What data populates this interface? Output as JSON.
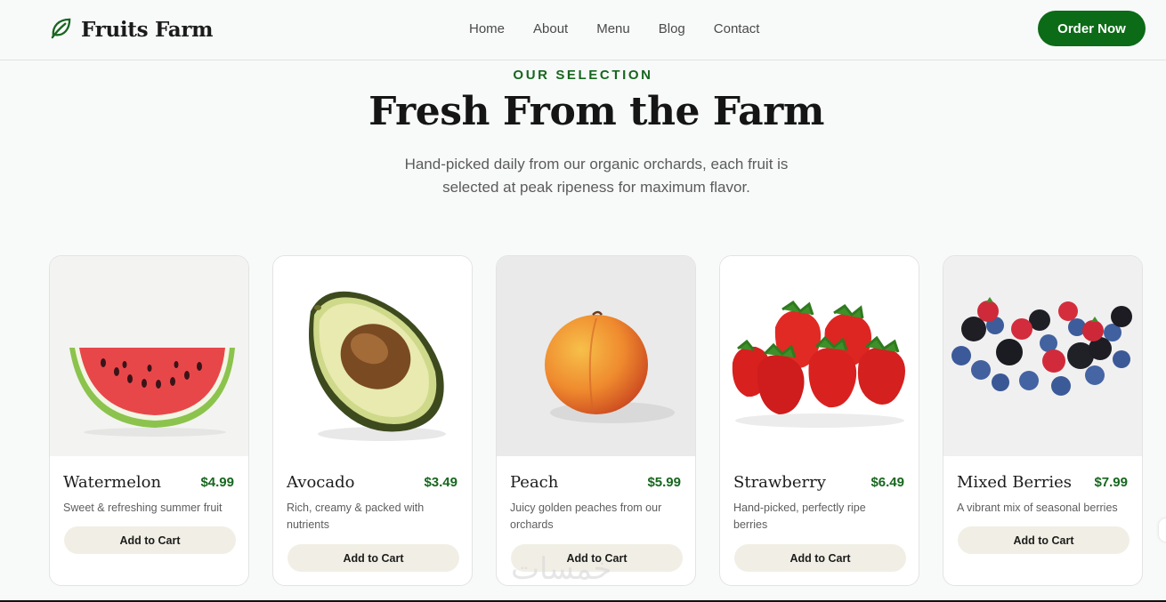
{
  "brand": {
    "name": "Fruits Farm",
    "icon": "leaf-icon",
    "color": "#17661f"
  },
  "nav": {
    "items": [
      "Home",
      "About",
      "Menu",
      "Blog",
      "Contact"
    ]
  },
  "header": {
    "cta_label": "Order Now"
  },
  "hero": {
    "eyebrow": "OUR SELECTION",
    "title": "Fresh From the Farm",
    "subtitle": "Hand-picked daily from our organic orchards, each fruit is selected at peak ripeness for maximum flavor."
  },
  "products": [
    {
      "name": "Watermelon",
      "price": "$4.99",
      "description": "Sweet & refreshing summer fruit",
      "button": "Add to Cart",
      "image": "watermelon-image"
    },
    {
      "name": "Avocado",
      "price": "$3.49",
      "description": "Rich, creamy & packed with nutrients",
      "button": "Add to Cart",
      "image": "avocado-image"
    },
    {
      "name": "Peach",
      "price": "$5.99",
      "description": "Juicy golden peaches from our orchards",
      "button": "Add to Cart",
      "image": "peach-image"
    },
    {
      "name": "Strawberry",
      "price": "$6.49",
      "description": "Hand-picked, perfectly ripe berries",
      "button": "Add to Cart",
      "image": "strawberry-image"
    },
    {
      "name": "Mixed Berries",
      "price": "$7.99",
      "description": "A vibrant mix of seasonal berries",
      "button": "Add to Cart",
      "image": "berries-image"
    }
  ],
  "watermark": "خمسات",
  "colors": {
    "accent": "#0c6b16",
    "button_bg": "#f1efe5",
    "page_bg": "#f8f9f9"
  }
}
